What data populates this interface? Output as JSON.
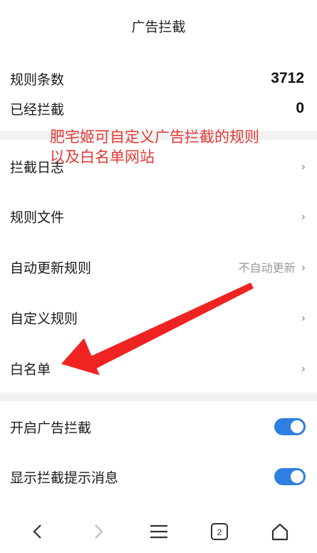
{
  "header": {
    "title": "广告拦截"
  },
  "stats": {
    "rules_label": "规则条数",
    "rules_value": "3712",
    "blocked_label": "已经拦截",
    "blocked_value": "0"
  },
  "annotation": {
    "line1": "肥宅姬可自定义广告拦截的规则",
    "line2": "以及白名单网站",
    "color": "#e53935"
  },
  "menu": {
    "block_log": "拦截日志",
    "rule_file": "规则文件",
    "auto_update": "自动更新规则",
    "auto_update_value": "不自动更新",
    "custom_rules": "自定义规则",
    "whitelist": "白名单"
  },
  "toggles": {
    "enable_adblock": {
      "label": "开启广告拦截",
      "on": true
    },
    "show_tip": {
      "label": "显示拦截提示消息",
      "on": true
    }
  },
  "nav": {
    "tab_count": "2"
  },
  "colors": {
    "accent": "#2f7fe0",
    "divider": "#f2f2f2"
  }
}
